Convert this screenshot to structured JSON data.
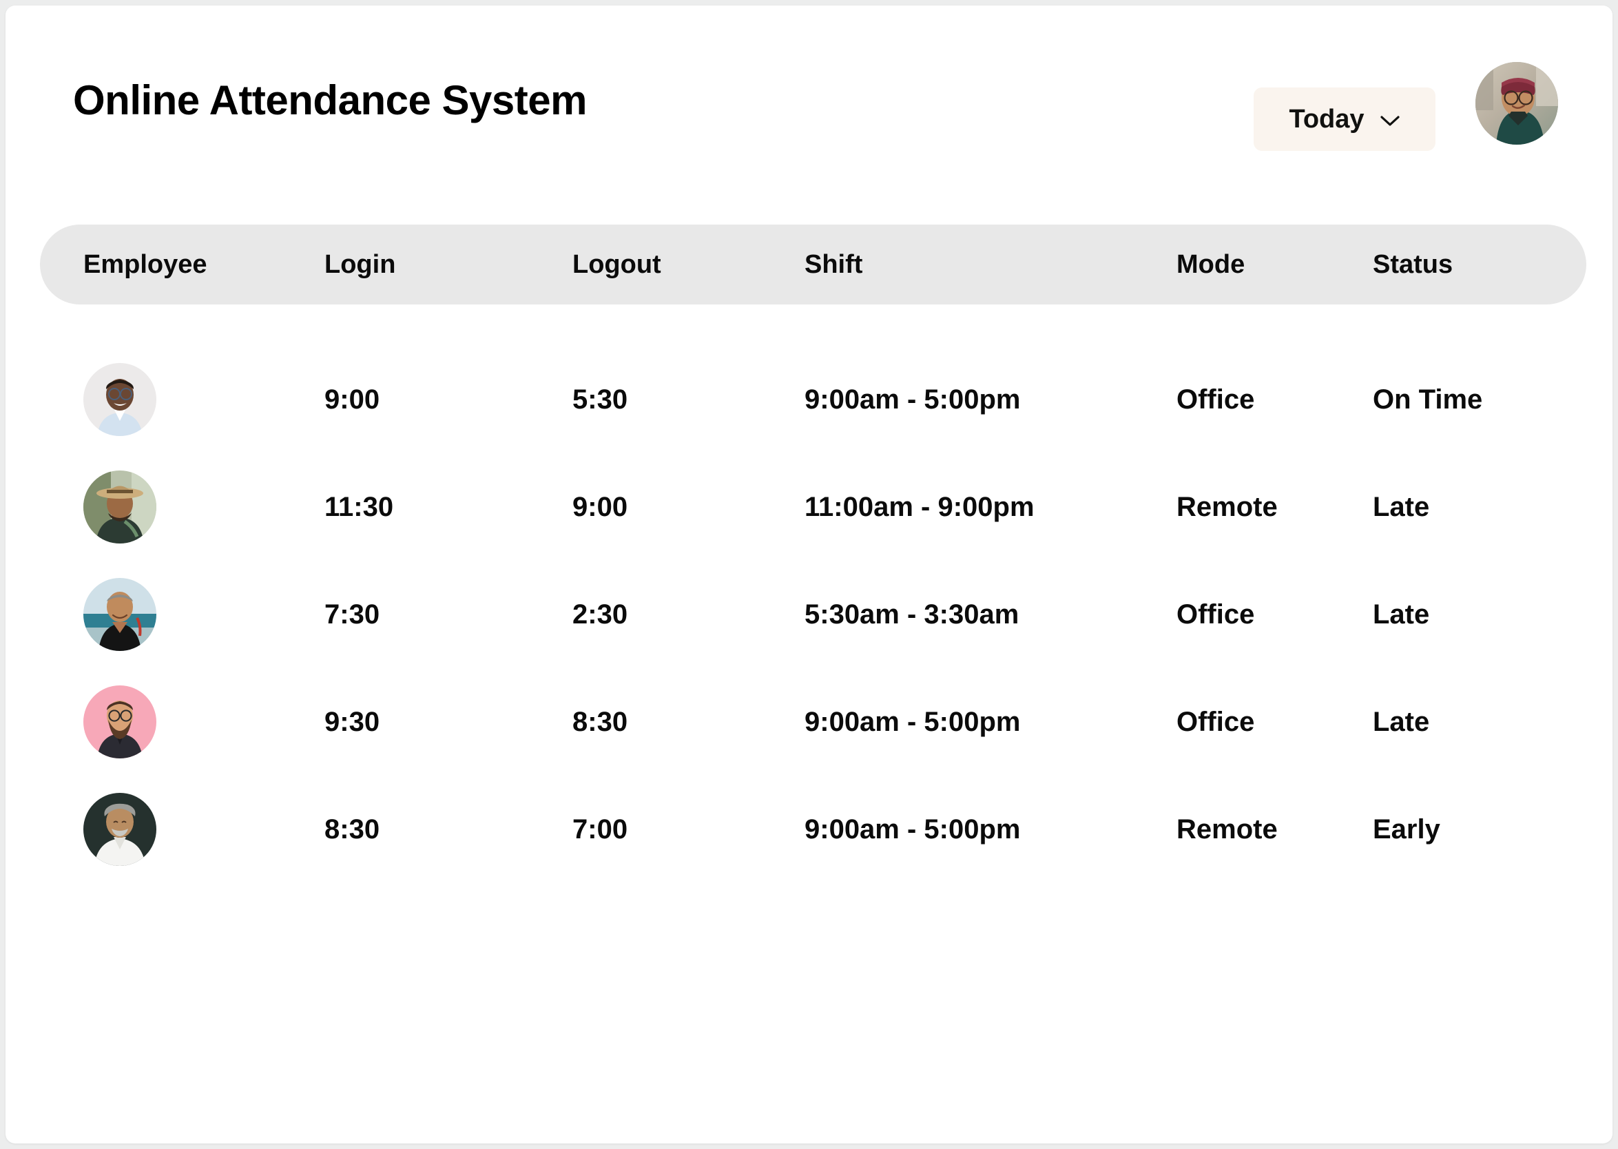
{
  "header": {
    "title": "Online Attendance System",
    "date_filter": {
      "label": "Today",
      "icon": "chevron-down-icon",
      "background": "#faf4ee"
    },
    "profile_avatar": {
      "icon": "avatar",
      "description": "person in maroon beanie and glasses wearing a teal jacket"
    }
  },
  "table": {
    "columns": [
      {
        "key": "employee",
        "label": "Employee"
      },
      {
        "key": "login",
        "label": "Login"
      },
      {
        "key": "logout",
        "label": "Logout"
      },
      {
        "key": "shift",
        "label": "Shift"
      },
      {
        "key": "mode",
        "label": "Mode"
      },
      {
        "key": "status",
        "label": "Status"
      }
    ],
    "header_background": "#e8e8e8",
    "rows": [
      {
        "employee_avatar": "man in light blue shirt with glasses",
        "login": "9:00",
        "logout": "5:30",
        "shift": "9:00am - 5:00pm",
        "mode": "Office",
        "status": "On Time",
        "status_color": "#0b0b0b"
      },
      {
        "employee_avatar": "man in straw hat outdoors",
        "login": "11:30",
        "logout": "9:00",
        "shift": "11:00am - 9:00pm",
        "mode": "Remote",
        "status": "Late",
        "status_color": "#b31212"
      },
      {
        "employee_avatar": "older man in black tank top at the beach",
        "login": "7:30",
        "logout": "2:30",
        "shift": "5:30am - 3:30am",
        "mode": "Office",
        "status": "Late",
        "status_color": "#b31212"
      },
      {
        "employee_avatar": "bearded man with glasses on pink background",
        "login": "9:30",
        "logout": "8:30",
        "shift": "9:00am - 5:00pm",
        "mode": "Office",
        "status": "Late",
        "status_color": "#b31212"
      },
      {
        "employee_avatar": "man with grey curly hair in white shirt",
        "login": "8:30",
        "logout": "7:00",
        "shift": "9:00am - 5:00pm",
        "mode": "Remote",
        "status": "Early",
        "status_color": "#127a12"
      }
    ]
  }
}
